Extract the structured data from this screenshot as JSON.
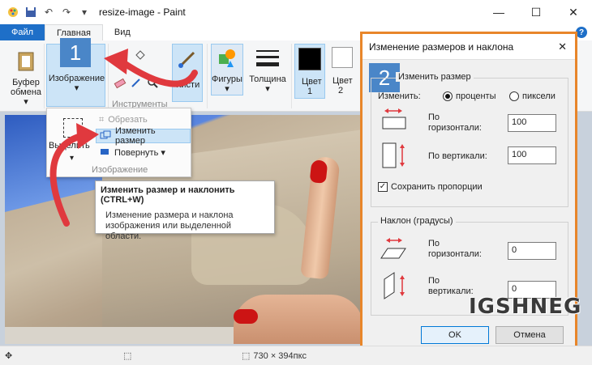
{
  "window": {
    "title": "resize-image - Paint",
    "controls": {
      "minimize": "—",
      "maximize": "☐",
      "close": "✕"
    }
  },
  "ribbon_tabs": [
    {
      "label": "Файл"
    },
    {
      "label": "Главная"
    },
    {
      "label": "Вид"
    }
  ],
  "ribbon": {
    "clipboard": {
      "label_line1": "Буфер",
      "label_line2": "обмена ▾"
    },
    "image": {
      "label": "Изображение",
      "arrow": "▾"
    },
    "tools": {
      "group_label": "Инструменты",
      "brushes_label": "Кисти"
    },
    "shapes": {
      "label": "Фигуры",
      "arrow": "▾"
    },
    "thickness": {
      "label": "Толщина",
      "arrow": "▾"
    },
    "color1": {
      "line1": "Цвет",
      "line2": "1"
    },
    "color2": {
      "line1": "Цвет",
      "line2": "2"
    }
  },
  "image_menu": {
    "select_label": "Выделить",
    "crop_label": "Обрезать",
    "resize_label": "Изменить размер",
    "rotate_label": "Повернуть ▾",
    "group_label": "Изображение"
  },
  "tooltip": {
    "title": "Изменить размер и наклонить (CTRL+W)",
    "line1": "Изменение размера и наклона",
    "line2": "изображения или выделенной",
    "line3": "области."
  },
  "dialog": {
    "title": "Изменение размеров и наклона",
    "resize_legend": "Изменить размер",
    "change_by_label": "Изменить:",
    "radio_percent": "проценты",
    "radio_pixels": "пиксели",
    "selected_unit": "percent",
    "horiz_label_line1": "По",
    "horiz_label_line2": "горизонтали:",
    "vert_label": "По вертикали:",
    "resize_horizontal": "100",
    "resize_vertical": "100",
    "keep_ratio_label": "Сохранить пропорции",
    "keep_ratio_checked": true,
    "skew_legend": "Наклон (градусы)",
    "skew_horiz_line1": "По",
    "skew_horiz_line2": "горизонтали:",
    "skew_vert_line1": "По",
    "skew_vert_line2": "вертикали:",
    "skew_horizontal": "0",
    "skew_vertical": "0",
    "ok_label": "OK",
    "cancel_label": "Отмена"
  },
  "statusbar": {
    "image_size": "730 × 394пкс"
  },
  "callouts": {
    "step1": "1",
    "step2": "2"
  },
  "watermark": "IGSHNEG",
  "colors": {
    "accent": "#1e6fc8",
    "highlight": "#cce4f7",
    "dialog_border": "#e8862a",
    "arrow": "#e0393e",
    "badge": "#4a86c8",
    "color1": "#000000",
    "color2": "#ffffff"
  }
}
